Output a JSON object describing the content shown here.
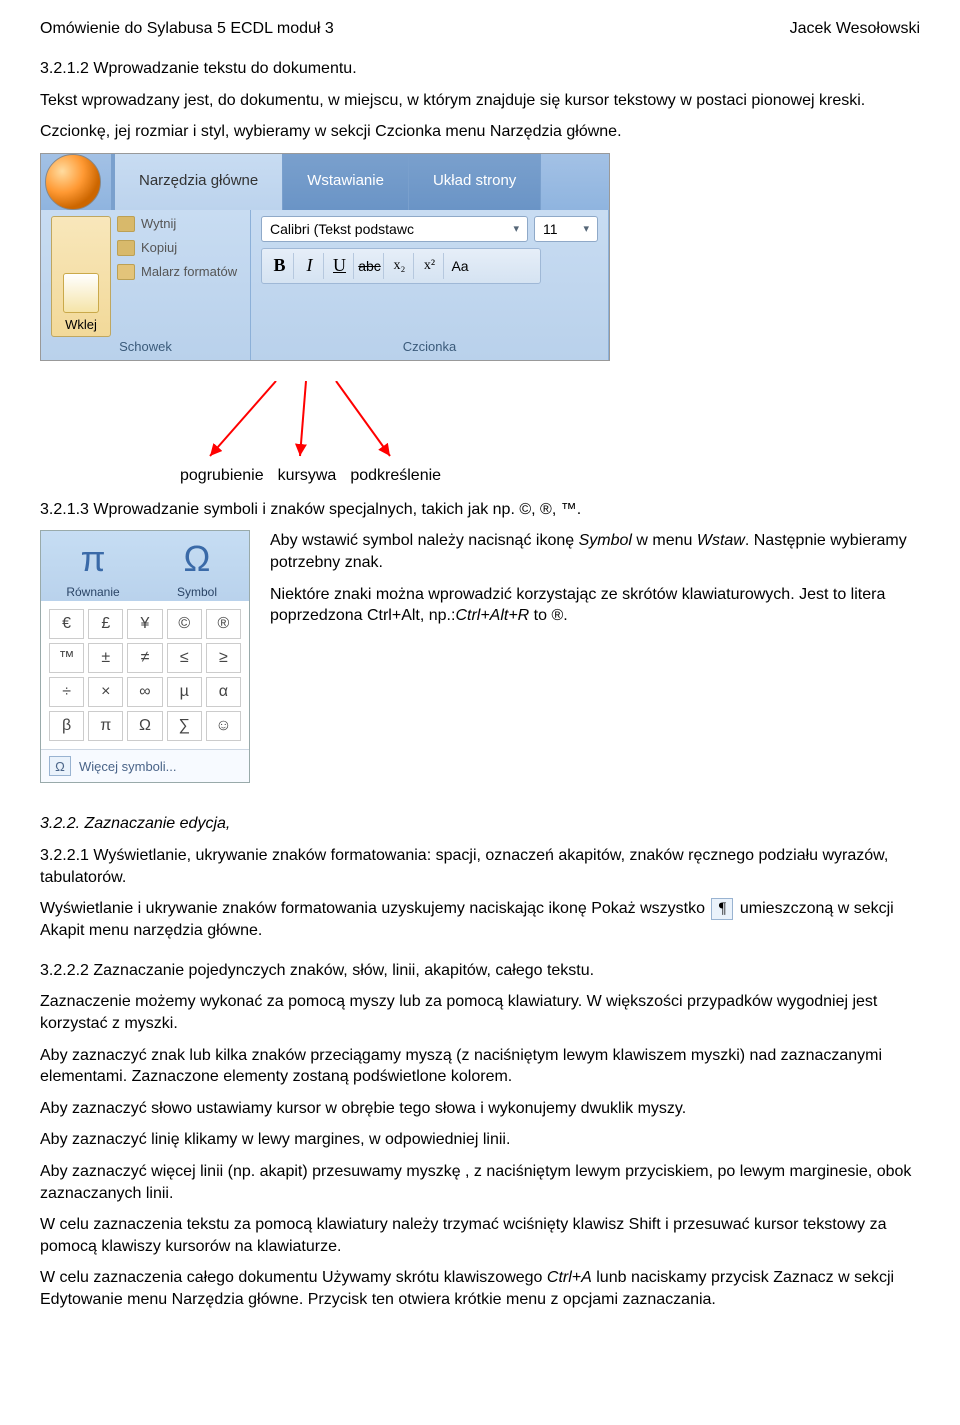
{
  "header": {
    "left": "Omówienie do Sylabusa 5 ECDL moduł 3",
    "right": "Jacek Wesołowski"
  },
  "intro": {
    "h1": "3.2.1.2 Wprowadzanie tekstu do dokumentu.",
    "p1": "Tekst wprowadzany jest, do dokumentu, w miejscu, w którym znajduje się kursor tekstowy w postaci pionowej kreski.",
    "p2": "Czcionkę, jej rozmiar i styl, wybieramy w sekcji Czcionka menu Narzędzia główne."
  },
  "ribbon": {
    "tabs": [
      "Narzędzia główne",
      "Wstawianie",
      "Układ strony"
    ],
    "clipboard": {
      "paste": "Wklej",
      "cut": "Wytnij",
      "copy": "Kopiuj",
      "painter": "Malarz formatów",
      "label": "Schowek"
    },
    "font": {
      "name": "Calibri (Tekst podstawc",
      "size": "11",
      "label": "Czcionka",
      "buttons": {
        "bold": "B",
        "italic": "I",
        "underline": "U",
        "strike": "abc",
        "sub": "x₂",
        "sup": "x²",
        "case": "Aa"
      }
    }
  },
  "arrow_labels": [
    "pogrubienie",
    "kursywa",
    "podkreślenie"
  ],
  "sec313": {
    "title": "3.2.1.3 Wprowadzanie symboli i znaków specjalnych, takich jak np. ©, ®, ™.",
    "p1a": "Aby wstawić symbol należy nacisnąć ikonę ",
    "p1b": "Symbol",
    "p1c": " w menu ",
    "p1d": "Wstaw",
    "p1e": ". Następnie wybieramy potrzebny znak.",
    "p2a": "Niektóre znaki można wprowadzić korzystając ze skrótów klawiaturowych. Jest to litera poprzedzona Ctrl+Alt, np.:",
    "p2b": "Ctrl+Alt+R",
    "p2c": " to ®."
  },
  "symbol_panel": {
    "equation": "Równanie",
    "symbol": "Symbol",
    "more": "Więcej symboli...",
    "grid": [
      [
        "€",
        "£",
        "¥",
        "©",
        "®"
      ],
      [
        "™",
        "±",
        "≠",
        "≤",
        "≥"
      ],
      [
        "÷",
        "×",
        "∞",
        "µ",
        "α"
      ],
      [
        "β",
        "π",
        "Ω",
        "∑",
        "☺"
      ]
    ],
    "foot_icon": "Ω"
  },
  "sec322": {
    "title": "3.2.2. Zaznaczanie edycja,",
    "s1": "3.2.2.1 Wyświetlanie, ukrywanie znaków formatowania: spacji, oznaczeń akapitów, znaków ręcznego podziału wyrazów, tabulatorów.",
    "p_show": "Wyświetlanie i ukrywanie znaków formatowania uzyskujemy naciskając ikonę Pokaż wszystko ",
    "p_show2": " umieszczoną w sekcji Akapit menu narzędzia główne.",
    "paragraph_mark": "¶",
    "s2": "3.2.2.2 Zaznaczanie pojedynczych znaków, słów, linii, akapitów, całego tekstu.",
    "p_a": "Zaznaczenie możemy wykonać za pomocą myszy lub za pomocą klawiatury. W większości przypadków wygodniej jest korzystać z myszki.",
    "p_b": "Aby zaznaczyć znak lub kilka znaków przeciągamy myszą (z naciśniętym lewym klawiszem myszki) nad zaznaczanymi elementami. Zaznaczone elementy zostaną podświetlone kolorem.",
    "p_c": "Aby zaznaczyć słowo ustawiamy kursor w obrębie tego słowa i wykonujemy dwuklik myszy.",
    "p_d": "Aby zaznaczyć linię klikamy w lewy margines, w odpowiedniej linii.",
    "p_e": "Aby zaznaczyć więcej linii (np. akapit) przesuwamy myszkę , z naciśniętym lewym przyciskiem, po lewym marginesie, obok zaznaczanych linii.",
    "p_f": "W celu zaznaczenia tekstu za pomocą klawiatury należy trzymać wciśnięty klawisz Shift i przesuwać kursor tekstowy za pomocą klawiszy kursorów na klawiaturze.",
    "p_g1": "W celu zaznaczenia całego dokumentu Używamy skrótu klawiszowego ",
    "p_g2": "Ctrl+A",
    "p_g3": "  lunb naciskamy przycisk Zaznacz w sekcji Edytowanie menu Narzędzia główne. Przycisk ten otwiera krótkie menu z opcjami zaznaczania."
  }
}
